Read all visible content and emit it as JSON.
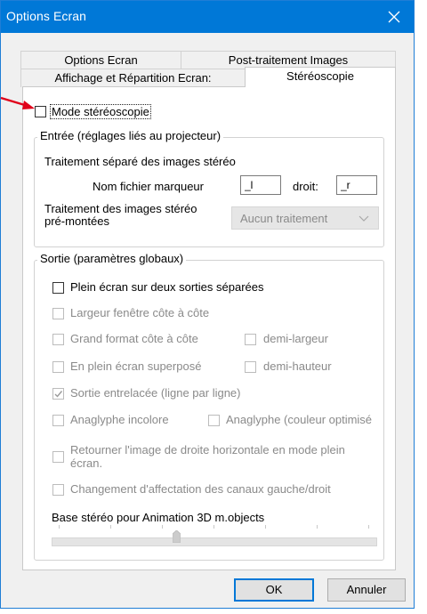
{
  "window": {
    "title": "Options Ecran"
  },
  "tabs": {
    "row1": [
      "Options Ecran",
      "Post-traitement Images"
    ],
    "row2": [
      "Affichage et Répartition Ecran:",
      "Stéréoscopie"
    ]
  },
  "stereo_mode": {
    "label": "Mode stéréoscopie",
    "checked": false
  },
  "input_group": {
    "legend": "Entrée (réglages liés au projecteur)",
    "separate_label": "Traitement séparé des images stéréo",
    "marker_label": "Nom fichier marqueur",
    "marker_value": "_l",
    "right_label": "droit:",
    "right_value": "_r",
    "premounted_label_1": "Traitement des images stéréo",
    "premounted_label_2": "pré-montées",
    "premounted_select": "Aucun traitement"
  },
  "output_group": {
    "legend": "Sortie (paramètres globaux)",
    "fullscreen_two": "Plein écran sur deux sorties séparées",
    "side_width": "Largeur fenêtre côte à côte",
    "large_format": "Grand format côte à côte",
    "half_width": "demi-largeur",
    "fullscreen_overlay": "En plein écran superposé",
    "half_height": "demi-hauteur",
    "interlaced": "Sortie entrelacée (ligne par ligne)",
    "anaglyph_colorless": "Anaglyphe incolore",
    "anaglyph_optimized": "Anaglyphe (couleur optimisé",
    "flip_right_1": "Retourner l'image de droite horizontale en mode plein",
    "flip_right_2": "écran.",
    "swap_channels": "Changement d'affectation des canaux gauche/droit",
    "base_label": "Base stéréo pour Animation 3D m.objects",
    "slider_position": 0.38
  },
  "buttons": {
    "ok": "OK",
    "cancel": "Annuler"
  },
  "colors": {
    "titlebar": "#0078d7",
    "arrow": "#e0001a",
    "dialog_bg": "#f0f0f0"
  }
}
